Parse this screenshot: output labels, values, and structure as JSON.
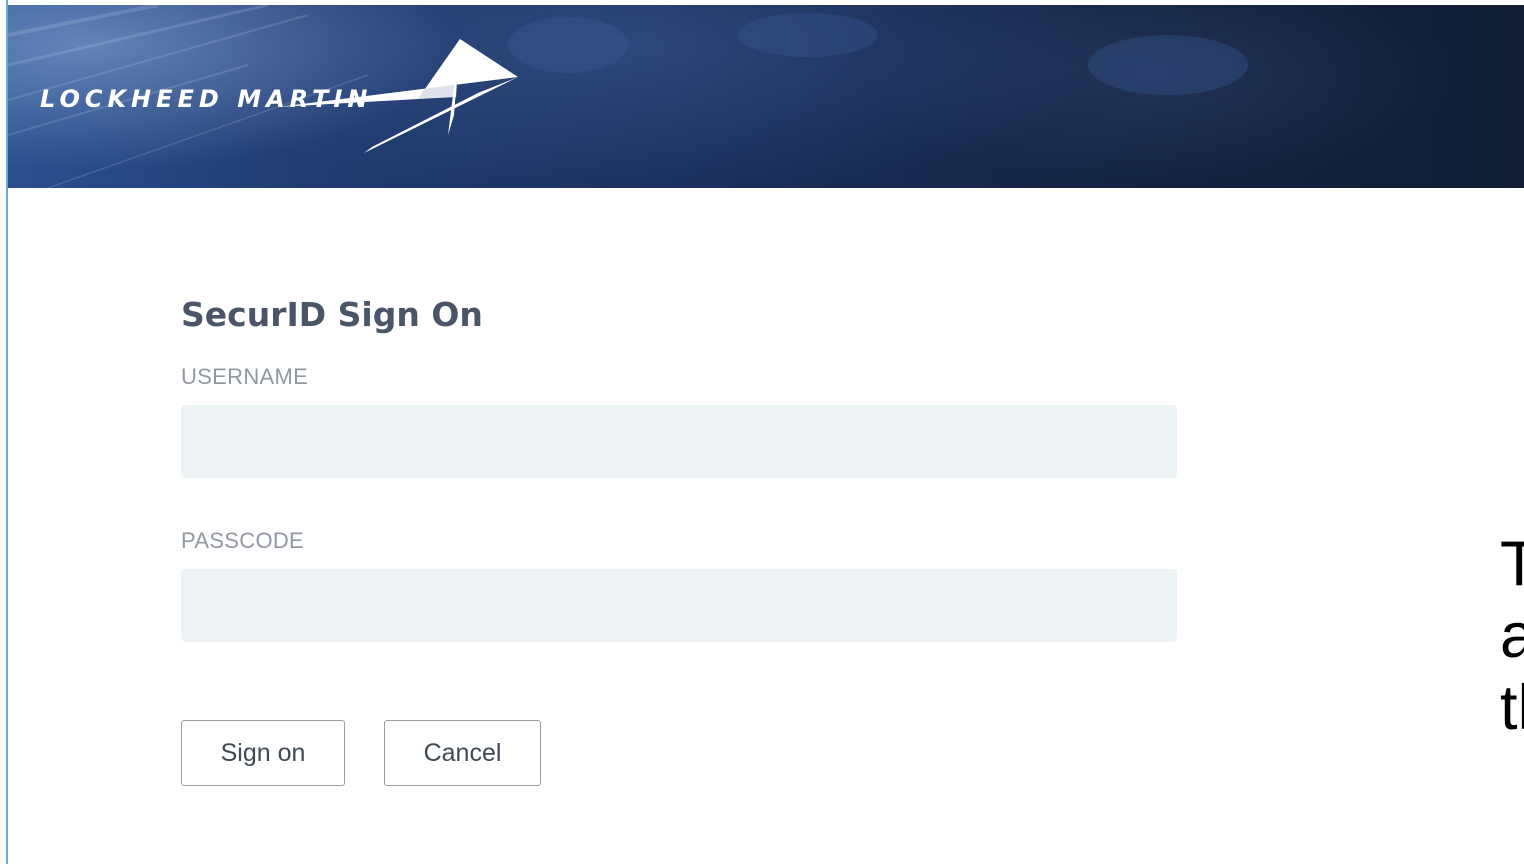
{
  "brand": {
    "logo_text": "LOCKHEED MARTIN",
    "logo_icon": "star-icon",
    "banner_color": "#1a2c55"
  },
  "form": {
    "title": "SecurID Sign On",
    "username_label": "USERNAME",
    "username_value": "",
    "passcode_label": "PASSCODE",
    "passcode_value": "",
    "input_background": "#eef3f6"
  },
  "buttons": {
    "sign_on": "Sign on",
    "cancel": "Cancel"
  },
  "side_text": {
    "line1": "T",
    "line2": "a",
    "line3": "th"
  }
}
